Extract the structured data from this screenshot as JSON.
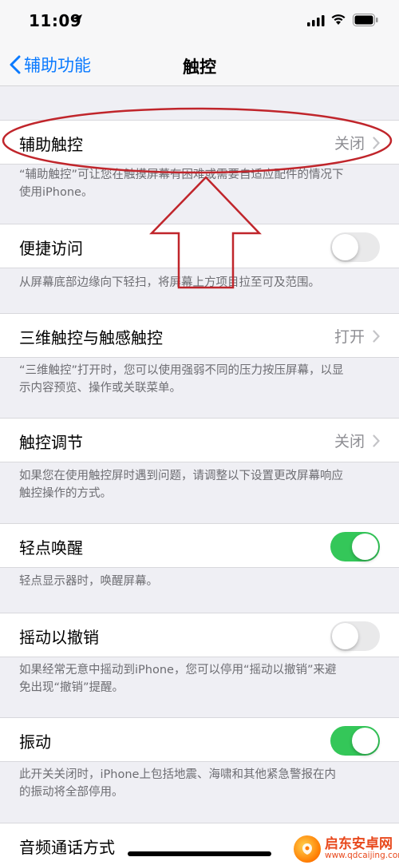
{
  "status_bar": {
    "time": "11:09"
  },
  "nav": {
    "back_label": "辅助功能",
    "title": "触控"
  },
  "sections": [
    {
      "label": "辅助触控",
      "detail": "关闭",
      "footer_lines": [
        "“辅助触控”可让您在触摸屏幕有困难或需要自适应配件的情况下",
        "使用iPhone。"
      ]
    },
    {
      "label": "便捷访问",
      "toggle": "off",
      "footer_lines": [
        "从屏幕底部边缘向下轻扫，将屏幕上方项目拉至可及范围。"
      ]
    },
    {
      "label": "三维触控与触感触控",
      "detail": "打开",
      "footer_lines": [
        "“三维触控”打开时，您可以使用强弱不同的压力按压屏幕，以显",
        "示内容预览、操作或关联菜单。"
      ]
    },
    {
      "label": "触控调节",
      "detail": "关闭",
      "footer_lines": [
        "如果您在使用触控屏时遇到问题，请调整以下设置更改屏幕响应",
        "触控操作的方式。"
      ]
    },
    {
      "label": "轻点唤醒",
      "toggle": "on",
      "footer_lines": [
        "轻点显示器时，唤醒屏幕。"
      ]
    },
    {
      "label": "摇动以撤销",
      "toggle": "off",
      "footer_lines": [
        "如果经常无意中摇动到iPhone，您可以停用“摇动以撤销”来避",
        "免出现“撤销”提醒。"
      ]
    },
    {
      "label": "振动",
      "toggle": "on",
      "footer_lines": [
        "此开关关闭时，iPhone上包括地震、海啸和其他紧急警报在内",
        "的振动将全部停用。"
      ]
    },
    {
      "label": "音频通话方式"
    }
  ],
  "watermark": {
    "title": "启东安卓网",
    "url": "www.qdcaijing.com"
  },
  "colors": {
    "accent": "#0a7aff",
    "toggle_on": "#34c759",
    "annotation": "#c0252b"
  }
}
